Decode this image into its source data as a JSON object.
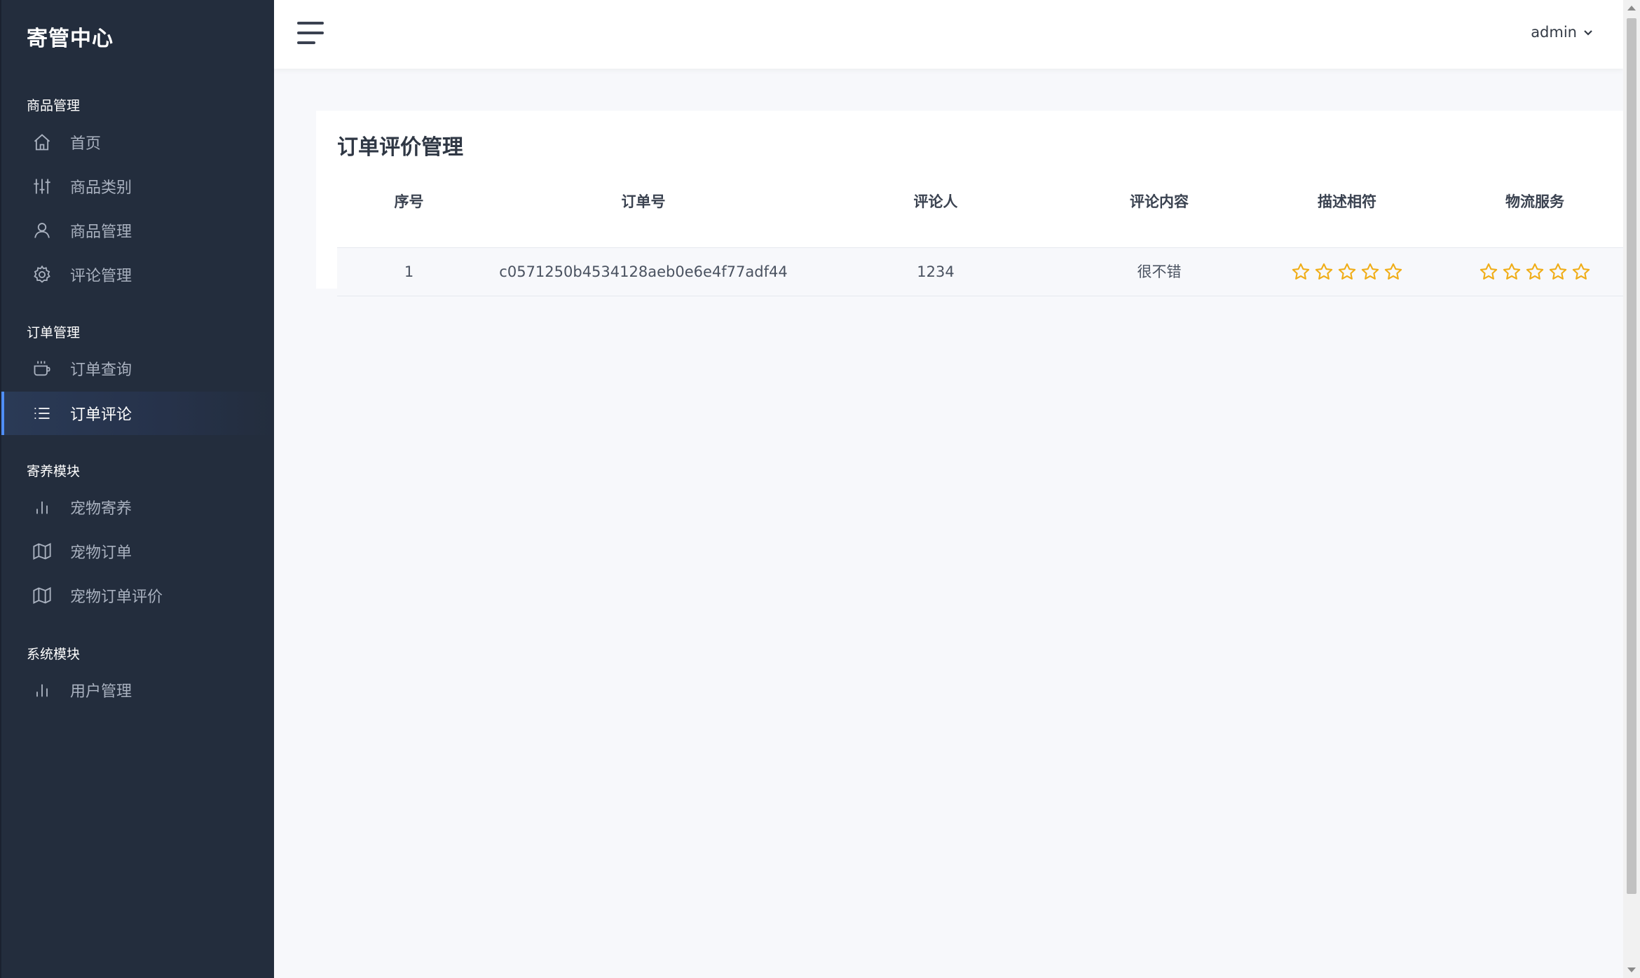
{
  "sidebar": {
    "brand": "寄管中心",
    "groups": [
      {
        "title": "商品管理",
        "items": [
          {
            "label": "首页",
            "icon": "home-icon"
          },
          {
            "label": "商品类别",
            "icon": "sliders-icon"
          },
          {
            "label": "商品管理",
            "icon": "user-icon"
          },
          {
            "label": "评论管理",
            "icon": "gear-icon"
          }
        ]
      },
      {
        "title": "订单管理",
        "items": [
          {
            "label": "订单查询",
            "icon": "cup-icon"
          },
          {
            "label": "订单评论",
            "icon": "list-icon",
            "active": true
          }
        ]
      },
      {
        "title": "寄养模块",
        "items": [
          {
            "label": "宠物寄养",
            "icon": "bar-chart-icon"
          },
          {
            "label": "宠物订单",
            "icon": "map-icon"
          },
          {
            "label": "宠物订单评价",
            "icon": "map-icon"
          }
        ]
      },
      {
        "title": "系统模块",
        "items": [
          {
            "label": "用户管理",
            "icon": "bar-chart-icon"
          }
        ]
      }
    ]
  },
  "header": {
    "user": "admin"
  },
  "main": {
    "title": "订单评价管理",
    "columns": [
      "序号",
      "订单号",
      "评论人",
      "评论内容",
      "描述相符",
      "物流服务"
    ],
    "rows": [
      {
        "index": "1",
        "order_no": "c0571250b4534128aeb0e6e4f77adf44",
        "reviewer": "1234",
        "content": "很不错",
        "description_rating": 0,
        "logistics_rating": 0,
        "max_rating": 5
      }
    ]
  },
  "colors": {
    "sidebar_bg": "#232d3d",
    "active_accent": "#4f8ef7",
    "star": "#f0ad17",
    "page_bg": "#f7f8fb"
  }
}
